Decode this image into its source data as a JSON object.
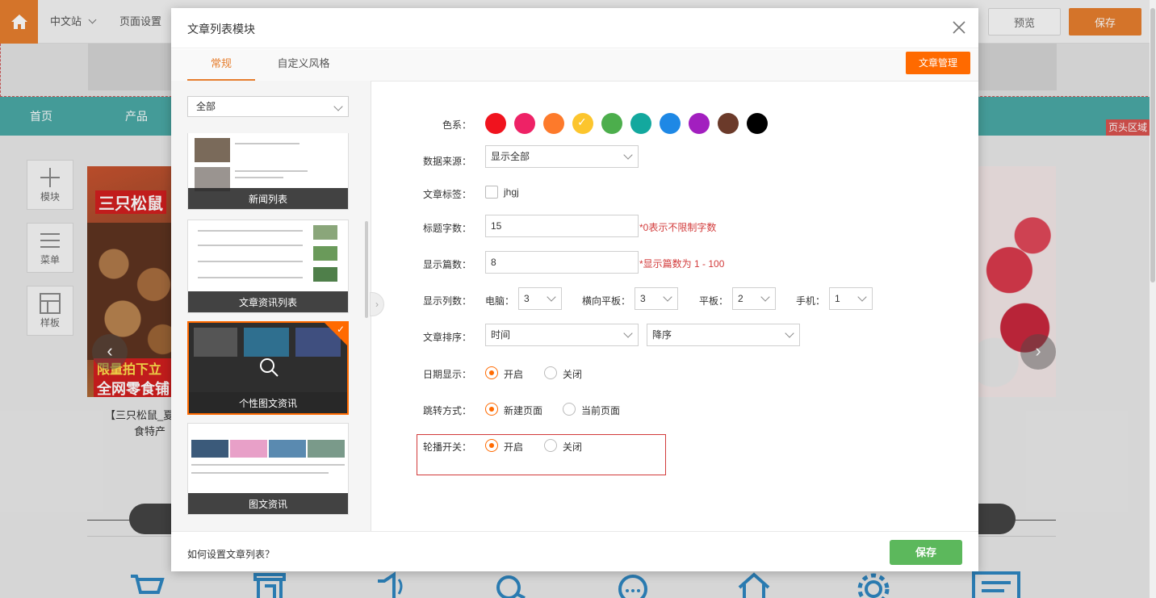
{
  "topbar": {
    "site": "中文站",
    "page_settings": "页面设置",
    "preview": "预览",
    "save": "保存"
  },
  "nav": {
    "items": [
      "首页",
      "产品"
    ],
    "header_area_tag": "页头区域"
  },
  "tools": [
    {
      "label": "模块",
      "icon": "plus-icon"
    },
    {
      "label": "菜单",
      "icon": "menu-icon"
    },
    {
      "label": "样板",
      "icon": "layout-icon"
    }
  ],
  "banner": {
    "brand": "三只松鼠",
    "promo_line1": "限量拍下立减",
    "promo_line2": "全网零食铺",
    "caption_line1": "【三只松鼠_夏",
    "caption_line2": "食特产"
  },
  "modal": {
    "title": "文章列表模块",
    "tabs": [
      "常规",
      "自定义风格"
    ],
    "manage_button": "文章管理",
    "filter": "全部",
    "templates": [
      "新闻列表",
      "文章资讯列表",
      "个性图文资讯",
      "图文资讯"
    ],
    "form": {
      "color_label": "色系：",
      "colors": [
        "#f0131e",
        "#ee2266",
        "#fd7a2b",
        "#fcc52d",
        "#4cae4c",
        "#13a89e",
        "#1e88e5",
        "#a21fbf",
        "#6b3a2a",
        "#000000"
      ],
      "selected_color": "#fcc52d",
      "source_label": "数据来源：",
      "source_value": "显示全部",
      "tag_label": "文章标签：",
      "tag_option": "jhgj",
      "title_len_label": "标题字数：",
      "title_len_value": "15",
      "title_len_hint": "*0表示不限制字数",
      "count_label": "显示篇数：",
      "count_value": "8",
      "count_hint": "*显示篇数为 1 - 100",
      "columns_label": "显示列数：",
      "pc_label": "电脑：",
      "pc_value": "3",
      "htab_label": "横向平板：",
      "htab_value": "3",
      "tab_label": "平板：",
      "tab_value": "2",
      "mobile_label": "手机：",
      "mobile_value": "1",
      "sort_label": "文章排序：",
      "sort_field": "时间",
      "sort_order": "降序",
      "date_label": "日期显示：",
      "on": "开启",
      "off": "关闭",
      "jump_label": "跳转方式：",
      "jump_new": "新建页面",
      "jump_current": "当前页面",
      "carousel_label": "轮播开关："
    },
    "help": "如何设置文章列表？",
    "save": "保存"
  }
}
